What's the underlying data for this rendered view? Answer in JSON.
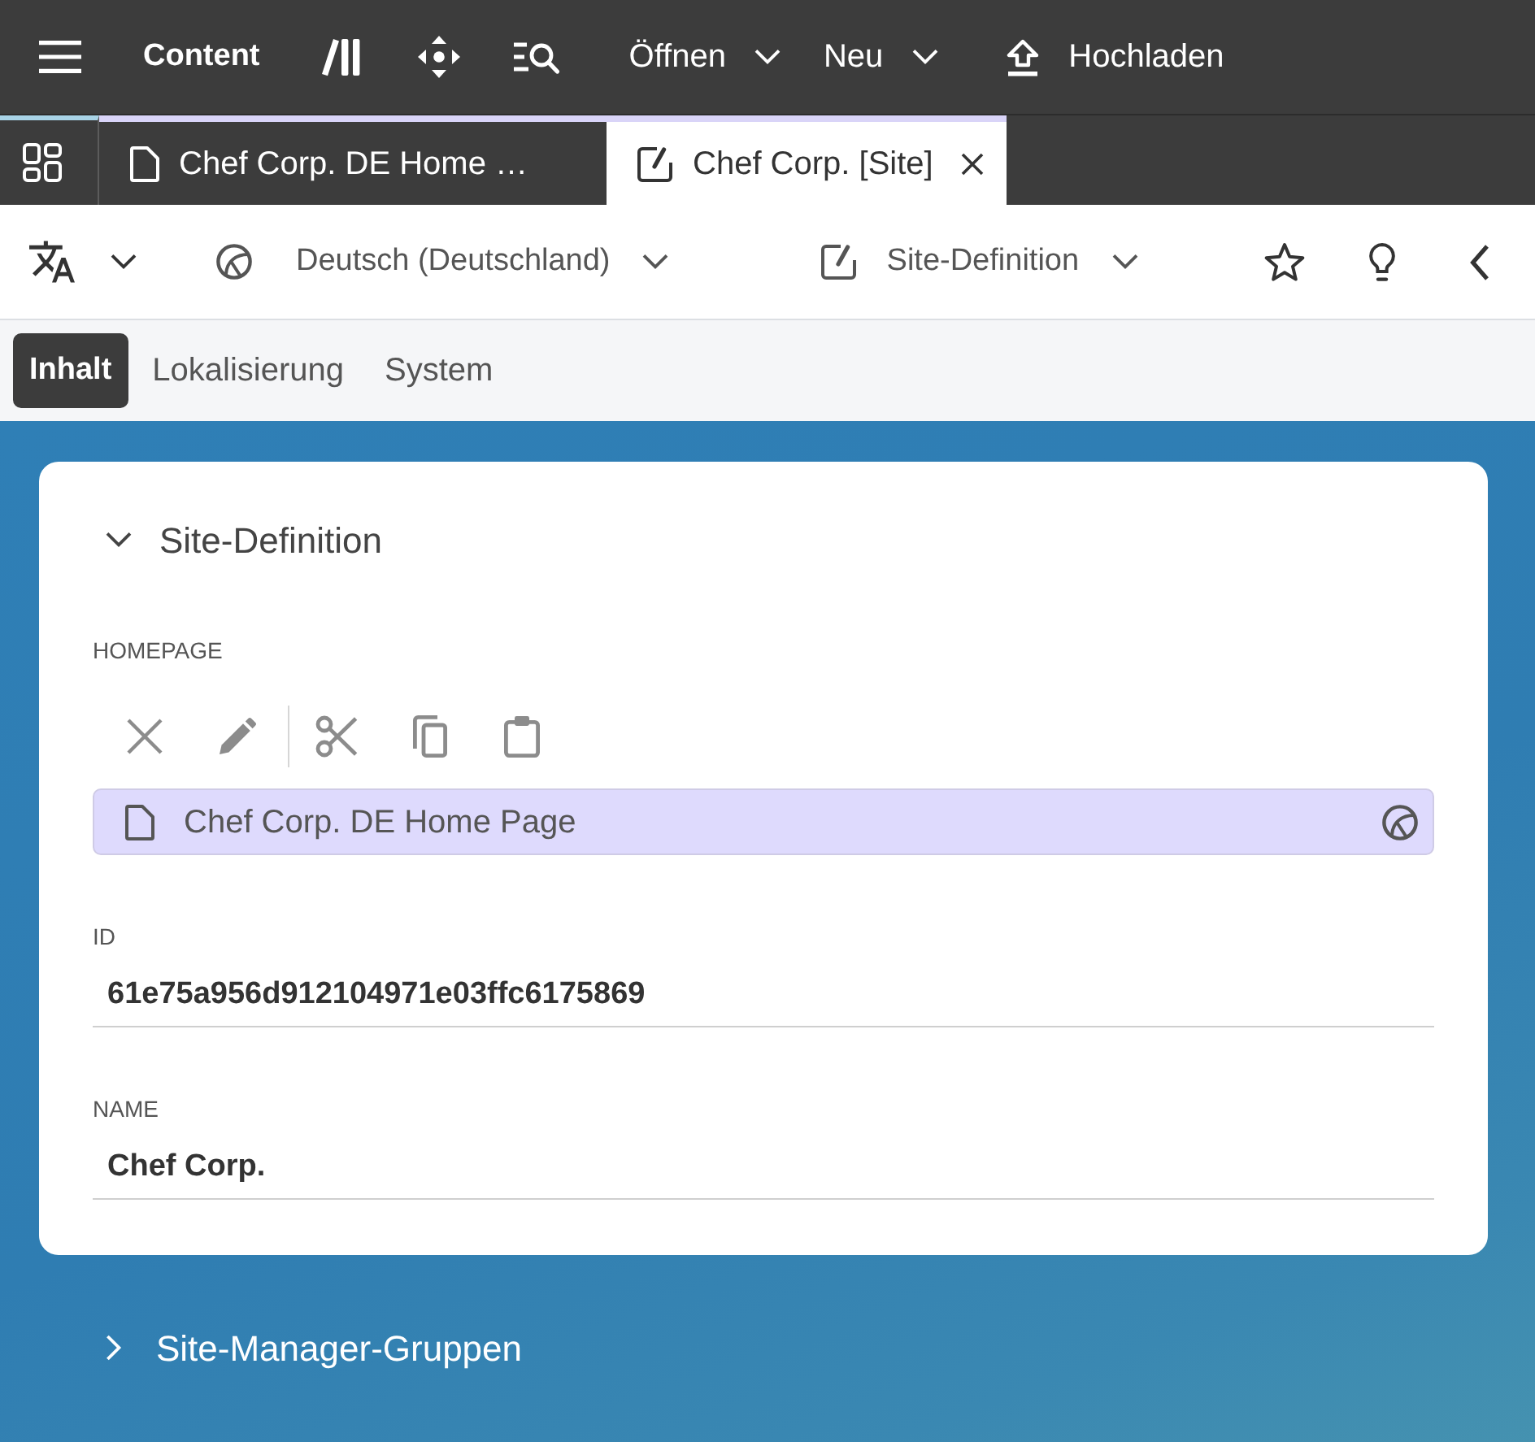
{
  "app_bar": {
    "title": "Content",
    "menus": [
      {
        "label": "Öffnen"
      },
      {
        "label": "Neu"
      }
    ],
    "upload": {
      "label": "Hochladen"
    }
  },
  "tabs": [
    {
      "label": "Chef Corp. DE Home …",
      "kind": "page",
      "selected": false
    },
    {
      "label": "Chef Corp. [Site]",
      "kind": "site",
      "selected": true
    }
  ],
  "toolbar": {
    "locale": "Deutsch (Deutschland)",
    "doc_type": "Site-Definition"
  },
  "view_tabs": [
    {
      "label": "Inhalt",
      "selected": true
    },
    {
      "label": "Lokalisierung",
      "selected": false
    },
    {
      "label": "System",
      "selected": false
    }
  ],
  "sections": [
    {
      "title": "Site-Definition",
      "expanded": true,
      "fields": [
        {
          "kind": "link",
          "label": "HOMEPAGE",
          "value": "Chef Corp. DE Home Page"
        },
        {
          "kind": "text",
          "label": "ID",
          "value": "61e75a956d912104971e03ffc6175869"
        },
        {
          "kind": "text",
          "label": "NAME",
          "value": "Chef Corp."
        }
      ]
    },
    {
      "title": "Site-Manager-Gruppen",
      "expanded": false
    }
  ]
}
